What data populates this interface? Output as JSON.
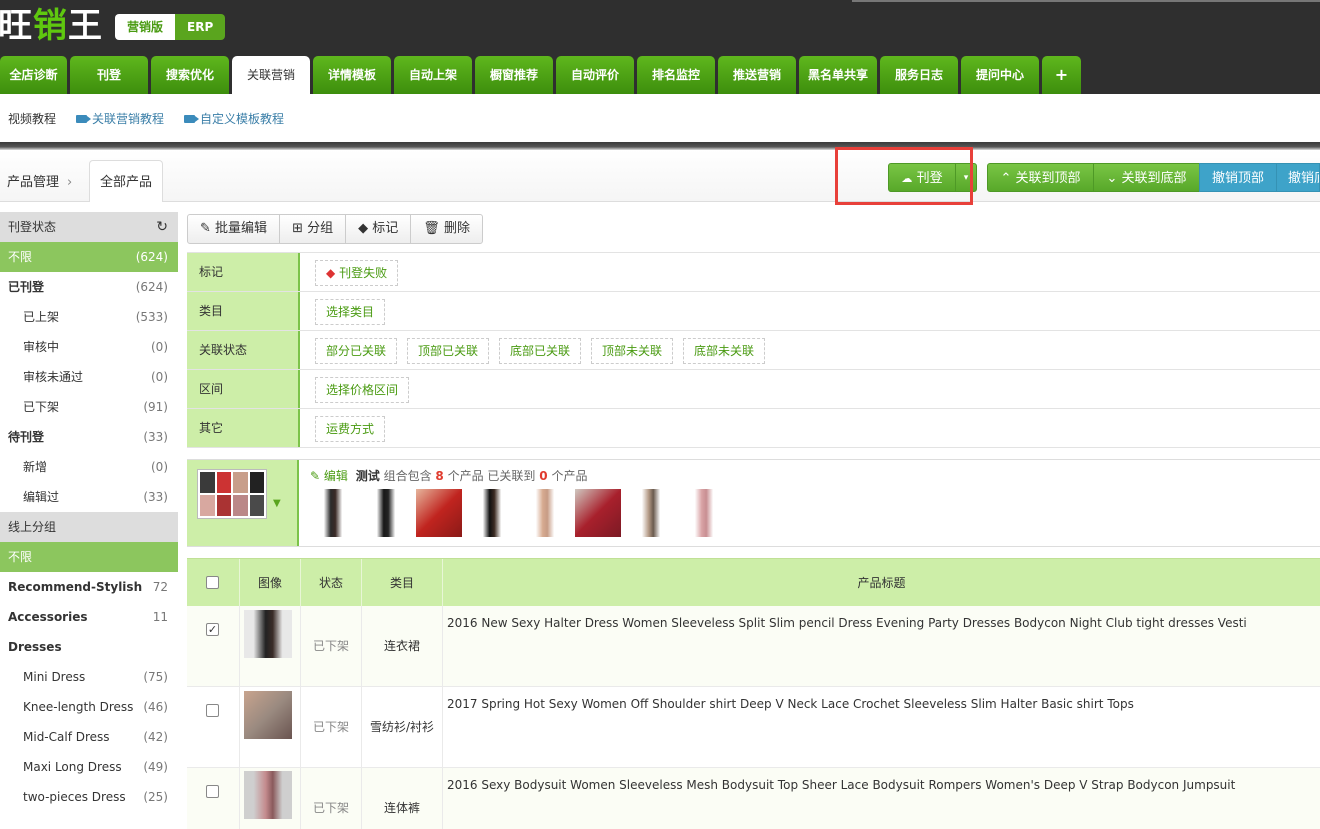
{
  "brand": {
    "part1": "旺",
    "part2": "销",
    "part3": "王"
  },
  "editions": [
    "营销版",
    "ERP"
  ],
  "nav": {
    "tabs": [
      "全店诊断",
      "刊登",
      "搜索优化",
      "关联营销",
      "详情模板",
      "自动上架",
      "橱窗推荐",
      "自动评价",
      "排名监控",
      "推送营销",
      "黑名单共享",
      "服务日志",
      "提问中心",
      "+"
    ],
    "active": "关联营销"
  },
  "subnav": {
    "label": "视频教程",
    "links": [
      "关联营销教程",
      "自定义模板教程"
    ]
  },
  "breadcrumb": {
    "root": "产品管理",
    "current": "全部产品"
  },
  "actions": {
    "publish": "刊登",
    "link_top": "关联到顶部",
    "link_bottom": "关联到底部",
    "undo_top": "撤销顶部",
    "undo_bottom": "撤销底部"
  },
  "sidebar": {
    "status_title": "刊登状态",
    "status": [
      {
        "label": "不限",
        "count": "(624)"
      },
      {
        "label": "已刊登",
        "count": "(624)"
      },
      {
        "label": "已上架",
        "count": "(533)"
      },
      {
        "label": "审核中",
        "count": "(0)"
      },
      {
        "label": "审核未通过",
        "count": "(0)"
      },
      {
        "label": "已下架",
        "count": "(91)"
      },
      {
        "label": "待刊登",
        "count": "(33)"
      },
      {
        "label": "新增",
        "count": "(0)"
      },
      {
        "label": "编辑过",
        "count": "(33)"
      }
    ],
    "group_title": "线上分组",
    "groups": [
      {
        "label": "不限",
        "count": ""
      },
      {
        "label": "Recommend-Stylish",
        "count": "72"
      },
      {
        "label": "Accessories",
        "count": "11"
      },
      {
        "label": "Dresses",
        "count": ""
      },
      {
        "label": "Mini Dress",
        "count": "(75)"
      },
      {
        "label": "Knee-length Dress",
        "count": "(46)"
      },
      {
        "label": "Mid-Calf Dress",
        "count": "(42)"
      },
      {
        "label": "Maxi Long Dress",
        "count": "(49)"
      },
      {
        "label": "two-pieces Dress",
        "count": "(25)"
      }
    ]
  },
  "toolbar": {
    "batch_edit": "批量编辑",
    "group": "分组",
    "mark": "标记",
    "delete": "删除"
  },
  "filters": [
    {
      "label": "标记",
      "options": [
        "刊登失败"
      ]
    },
    {
      "label": "类目",
      "options": [
        "选择类目"
      ]
    },
    {
      "label": "关联状态",
      "options": [
        "部分已关联",
        "顶部已关联",
        "底部已关联",
        "顶部未关联",
        "底部未关联"
      ]
    },
    {
      "label": "区间",
      "options": [
        "选择价格区间"
      ]
    },
    {
      "label": "其它",
      "options": [
        "运费方式"
      ]
    }
  ],
  "group_info": {
    "edit": "编辑",
    "name": "测试",
    "t1": "组合包含",
    "count": "8",
    "t2": "个产品 已关联到",
    "linked": "0",
    "t3": "个产品"
  },
  "table": {
    "headers": [
      "图像",
      "状态",
      "类目",
      "产品标题"
    ],
    "rows": [
      {
        "checked": true,
        "status": "已下架",
        "category": "连衣裙",
        "title": "2016 New Sexy Halter Dress Women Sleeveless Split Slim pencil Dress Evening Party Dresses Bodycon Night Club tight dresses Vesti"
      },
      {
        "checked": false,
        "status": "已下架",
        "category": "雪纺衫/衬衫",
        "title": "2017 Spring Hot Sexy Women Off Shoulder shirt Deep V Neck Lace Crochet Sleeveless Slim Halter Basic shirt Tops"
      },
      {
        "checked": false,
        "status": "已下架",
        "category": "连体裤",
        "title": "2016 Sexy Bodysuit Women Sleeveless Mesh Bodysuit Top Sheer Lace Bodysuit Rompers Women's Deep V Strap Bodycon Jumpsuit"
      }
    ]
  }
}
